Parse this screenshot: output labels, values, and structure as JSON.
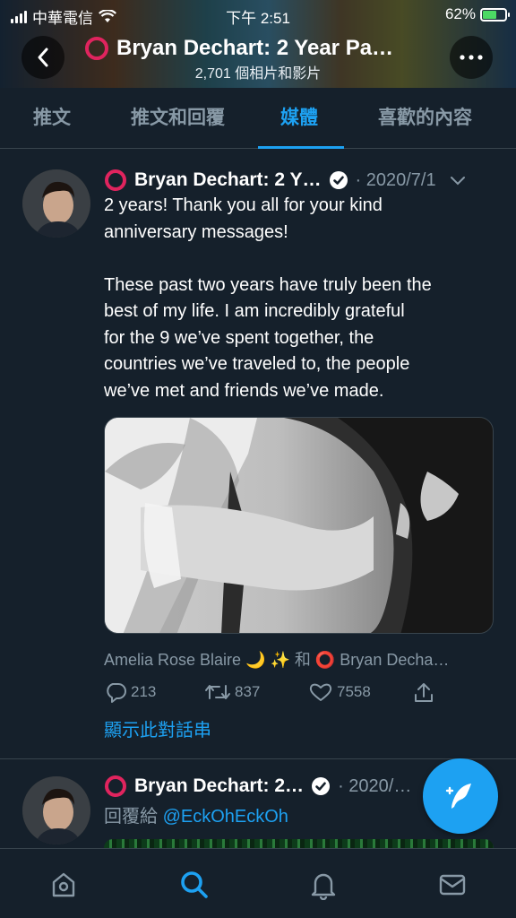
{
  "status": {
    "carrier": "中華電信",
    "time": "下午 2:51",
    "battery": "62%",
    "battery_level": 0.62
  },
  "header": {
    "title": "Bryan Dechart: 2 Year Pa…",
    "subtitle": "2,701 個相片和影片",
    "back_icon": "chevron-left-icon",
    "more_icon": "more-icon"
  },
  "tabs": [
    {
      "label": "推文"
    },
    {
      "label": "推文和回覆"
    },
    {
      "label": "媒體",
      "active": true
    },
    {
      "label": "喜歡的內容"
    }
  ],
  "tweets": [
    {
      "name": "Bryan Dechart: 2 Y…",
      "date": "· 2020/7/1",
      "text_lines": [
        "2 years! Thank you all for your kind",
        "anniversary messages!",
        "",
        "These past two years have truly been the",
        "best of my life. I am incredibly grateful",
        "for the 9 we’ve spent together, the",
        "countries we’ve traveled to, the people",
        "we’ve met and friends we’ve made."
      ],
      "tagged": "Amelia Rose Blaire 🌙 ✨ 和 ⭕ Bryan Decha…",
      "replies": "213",
      "retweets": "837",
      "likes": "7558",
      "thread_link": "顯示此對話串"
    },
    {
      "name": "Bryan Dechart: 2…",
      "date": "· 2020/…",
      "reply_prefix": "回覆給",
      "reply_to": "@EckOhEckOh"
    }
  ],
  "colors": {
    "accent": "#1da1f2",
    "background": "#15202b",
    "muted": "#8899a6",
    "divider": "#38444d"
  },
  "nav": [
    "home-icon",
    "search-icon",
    "notifications-icon",
    "messages-icon"
  ]
}
